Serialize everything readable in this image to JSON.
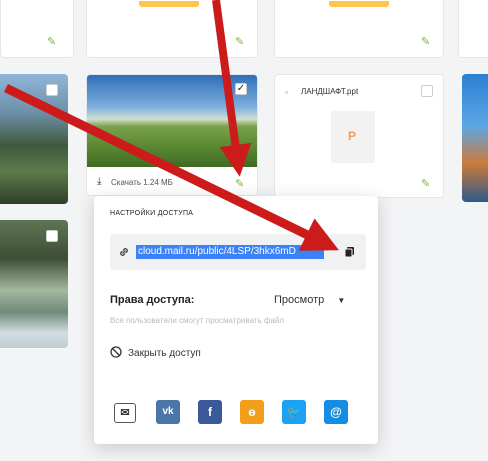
{
  "popup": {
    "title": "Настройки доступа",
    "link": "cloud.mail.ru/public/4LSP/3hkx6mD",
    "access_label": "Права доступа:",
    "access_value": "Просмотр",
    "access_hint": "Все пользователи смогут просматривать файл",
    "close_access": "Закрыть доступ"
  },
  "tiles": {
    "download_label": "Скачать 1.24 МБ",
    "file_name": "ЛАНДШАФТ.ppt",
    "file_letter": "P"
  },
  "share_icons": [
    "email-icon",
    "vk-icon",
    "facebook-icon",
    "odnoklassniki-icon",
    "twitter-icon",
    "moimir-icon"
  ],
  "colors": {
    "arrow": "#cc1b1b",
    "accent_yellow": "#ffc64a",
    "pencil_green": "#7cb342",
    "vk": "#4a76a8",
    "facebook": "#3b5998",
    "ok": "#f2a01b",
    "twitter": "#1da1f2",
    "moimir": "#168de2"
  }
}
